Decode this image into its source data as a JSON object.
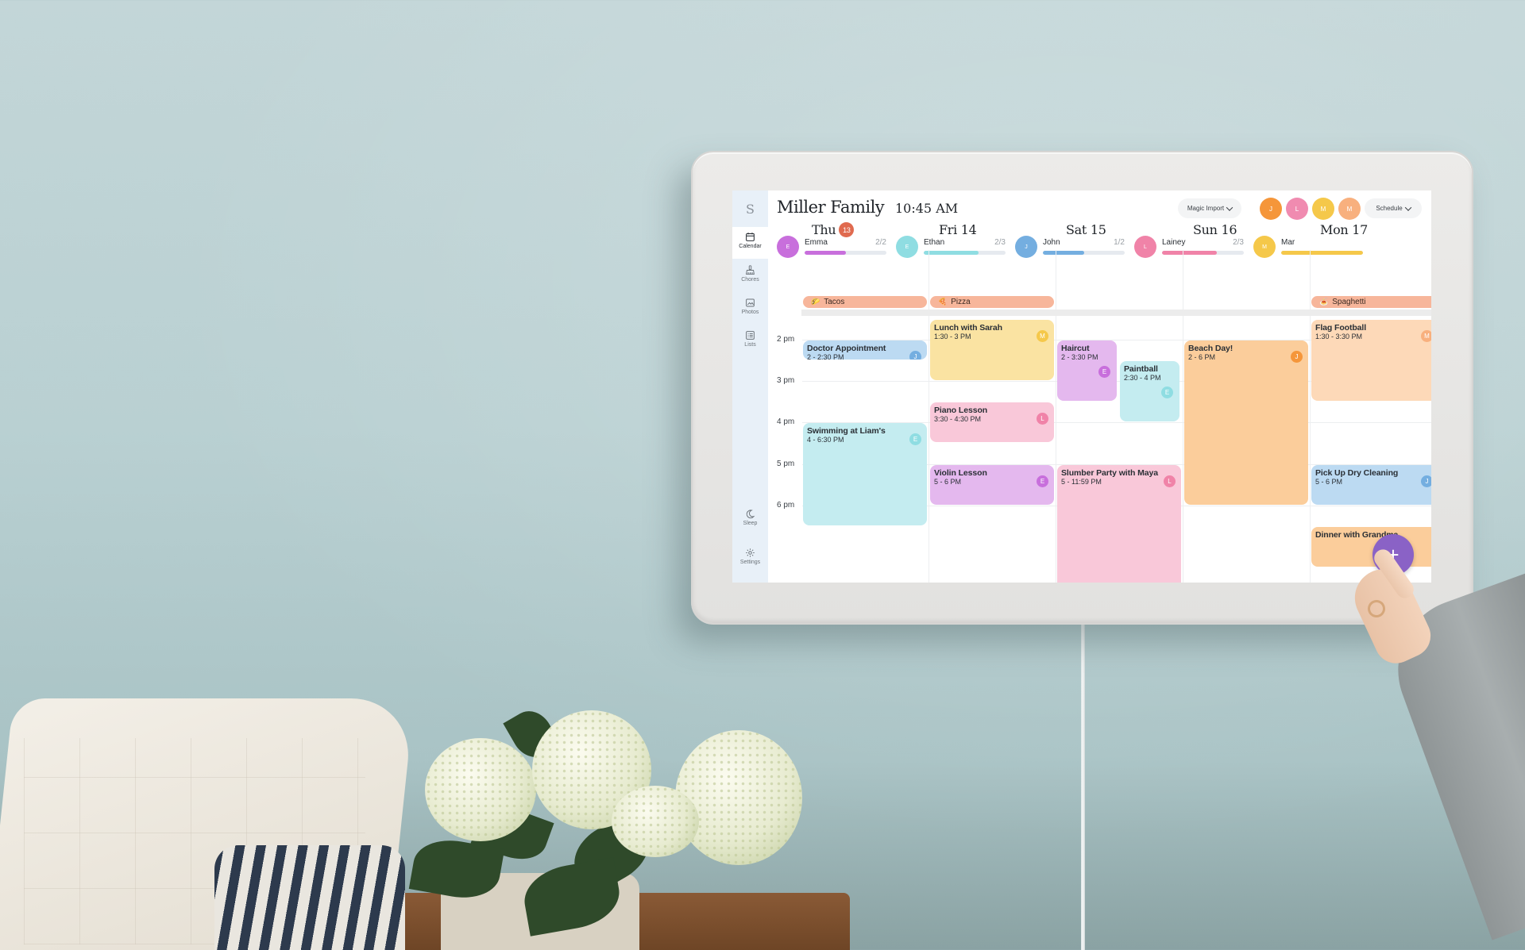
{
  "app": {
    "logo_letter": "S",
    "family_name": "Miller Family",
    "time": "10:45 AM"
  },
  "sidebar": {
    "items": [
      {
        "label": "Calendar",
        "icon": "calendar-icon",
        "active": true
      },
      {
        "label": "Chores",
        "icon": "broom-icon",
        "active": false
      },
      {
        "label": "Photos",
        "icon": "image-icon",
        "active": false
      },
      {
        "label": "Lists",
        "icon": "list-icon",
        "active": false
      },
      {
        "label": "Sleep",
        "icon": "moon-icon",
        "active": false
      },
      {
        "label": "Settings",
        "icon": "gear-icon",
        "active": false
      }
    ]
  },
  "header": {
    "magic_import_label": "Magic Import",
    "schedule_label": "Schedule",
    "avatars": [
      {
        "initial": "J",
        "color": "#f5963a"
      },
      {
        "initial": "L",
        "color": "#f08bb0"
      },
      {
        "initial": "M",
        "color": "#f5c84a"
      },
      {
        "initial": "M",
        "color": "#f8b07e"
      }
    ]
  },
  "members": [
    {
      "initial": "E",
      "name": "Emma",
      "done": 2,
      "total": 2,
      "count_label": "2/2",
      "progress": 0.5,
      "color": "#c86fdc"
    },
    {
      "initial": "E",
      "name": "Ethan",
      "done": 2,
      "total": 3,
      "count_label": "2/3",
      "progress": 0.67,
      "color": "#8fdde2"
    },
    {
      "initial": "J",
      "name": "John",
      "done": 1,
      "total": 2,
      "count_label": "1/2",
      "progress": 0.5,
      "color": "#74aee0"
    },
    {
      "initial": "L",
      "name": "Lainey",
      "done": 2,
      "total": 3,
      "count_label": "2/3",
      "progress": 0.67,
      "color": "#f083a8"
    },
    {
      "initial": "M",
      "name": "Mar",
      "count_label": "",
      "progress": 1.0,
      "color": "#f5c84a"
    }
  ],
  "days": [
    {
      "label": "Thu",
      "date": "13",
      "today": true,
      "meal": {
        "icon": "🌮",
        "name": "Tacos"
      }
    },
    {
      "label": "Fri 14",
      "today": false,
      "meal": {
        "icon": "🍕",
        "name": "Pizza"
      }
    },
    {
      "label": "Sat 15",
      "today": false,
      "meal": null
    },
    {
      "label": "Sun 16",
      "today": false,
      "meal": null
    },
    {
      "label": "Mon 17",
      "today": false,
      "meal": {
        "icon": "🍝",
        "name": "Spaghetti"
      }
    }
  ],
  "hours": [
    "2 pm",
    "3 pm",
    "4 pm",
    "5 pm",
    "6 pm"
  ],
  "view_start_hour": 13.5,
  "events": [
    {
      "day": 0,
      "title": "Doctor Appointment",
      "time": "2 - 2:30 PM",
      "start": 14,
      "end": 14.5,
      "bg": "#bcdaf2",
      "who": "J",
      "who_color": "#74aee0",
      "lane": 0,
      "lanes": 1
    },
    {
      "day": 0,
      "title": "Swimming at Liam's",
      "time": "4 - 6:30 PM",
      "start": 16,
      "end": 18.5,
      "bg": "#c4ecf0",
      "who": "E",
      "who_color": "#8fdde2",
      "lane": 0,
      "lanes": 1
    },
    {
      "day": 1,
      "title": "Lunch with Sarah",
      "time": "1:30 - 3 PM",
      "start": 13.5,
      "end": 15,
      "bg": "#fae3a2",
      "who": "M",
      "who_color": "#f5c84a",
      "lane": 0,
      "lanes": 1
    },
    {
      "day": 1,
      "title": "Piano Lesson",
      "time": "3:30 - 4:30 PM",
      "start": 15.5,
      "end": 16.5,
      "bg": "#f9c8d9",
      "who": "L",
      "who_color": "#f083a8",
      "lane": 0,
      "lanes": 1
    },
    {
      "day": 1,
      "title": "Violin Lesson",
      "time": "5 - 6 PM",
      "start": 17,
      "end": 18,
      "bg": "#e4b8ee",
      "who": "E",
      "who_color": "#c86fdc",
      "lane": 0,
      "lanes": 1
    },
    {
      "day": 2,
      "title": "Haircut",
      "time": "2 - 3:30 PM",
      "start": 14,
      "end": 15.5,
      "bg": "#e4b8ee",
      "who": "E",
      "who_color": "#c86fdc",
      "lane": 0,
      "lanes": 2
    },
    {
      "day": 2,
      "title": "Paintball",
      "time": "2:30 - 4 PM",
      "start": 14.5,
      "end": 16,
      "bg": "#c4ecf0",
      "who": "E",
      "who_color": "#8fdde2",
      "lane": 1,
      "lanes": 2
    },
    {
      "day": 2,
      "title": "Slumber Party with Maya",
      "time": "5 - 11:59 PM",
      "start": 17,
      "end": 23.98,
      "bg": "#f9c8d9",
      "who": "L",
      "who_color": "#f083a8",
      "lane": 0,
      "lanes": 1
    },
    {
      "day": 3,
      "title": "Beach Day!",
      "time": "2 - 6 PM",
      "start": 14,
      "end": 18,
      "bg": "#fbcd9b",
      "who": "J",
      "who_color": "#f5963a",
      "lane": 0,
      "lanes": 1
    },
    {
      "day": 4,
      "title": "Flag Football",
      "time": "1:30 - 3:30 PM",
      "start": 13.5,
      "end": 15.5,
      "bg": "#fdd9b8",
      "who": "M",
      "who_color": "#f8b07e",
      "lane": 0,
      "lanes": 1
    },
    {
      "day": 4,
      "title": "Pick Up Dry Cleaning",
      "time": "5 - 6 PM",
      "start": 17,
      "end": 18,
      "bg": "#bcdaf2",
      "who": "J",
      "who_color": "#74aee0",
      "lane": 0,
      "lanes": 1
    },
    {
      "day": 4,
      "title": "Dinner with Grandma",
      "time": "",
      "start": 18.5,
      "end": 19.5,
      "bg": "#fbcd9b",
      "who": "",
      "who_color": "",
      "lane": 0,
      "lanes": 1
    }
  ],
  "fab": {
    "icon": "plus-icon",
    "label": "+"
  }
}
